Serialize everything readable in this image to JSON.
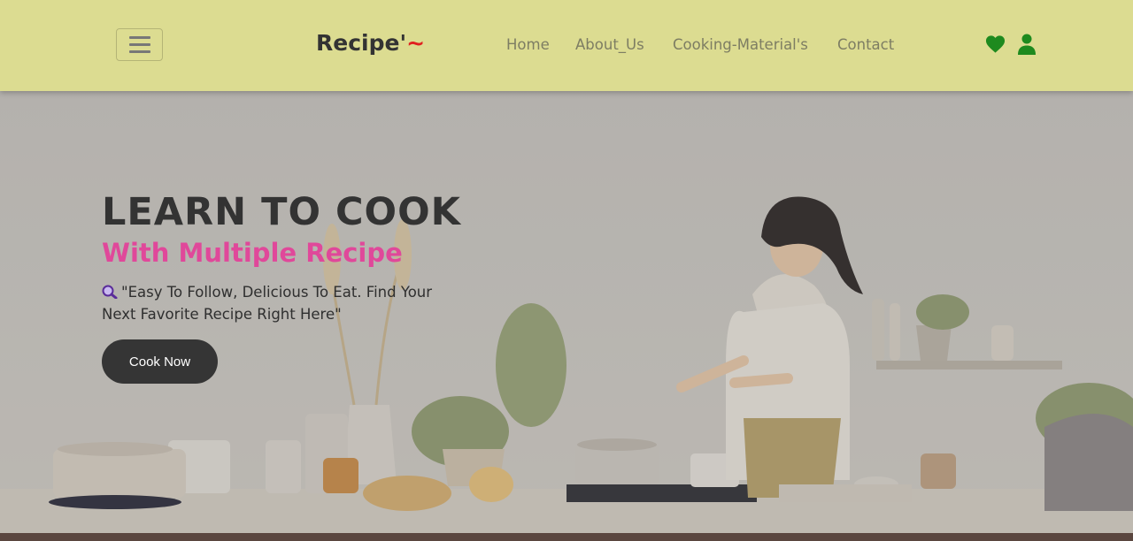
{
  "header": {
    "brand": "Recipe'",
    "brand_tilde": "~",
    "nav": {
      "home": "Home",
      "about": "About_Us",
      "cooking": "Cooking-Material's",
      "contact": "Contact"
    },
    "icons": {
      "menu": "hamburger-icon",
      "wishlist": "heart-icon",
      "account": "user-icon"
    },
    "colors": {
      "background": "#dcdc91",
      "icon": "#1e8a1e",
      "tilde": "#e02020"
    }
  },
  "hero": {
    "title": "LEARN TO COOK",
    "subtitle": "With Multiple Recipe",
    "quote": "\"Easy To Follow, Delicious To Eat. Find Your Next Favorite Recipe Right Here\"",
    "quote_icon": "magnifier-emoji-icon",
    "button_label": "Cook Now",
    "colors": {
      "subtitle": "#e0489a",
      "button": "#353535"
    }
  }
}
